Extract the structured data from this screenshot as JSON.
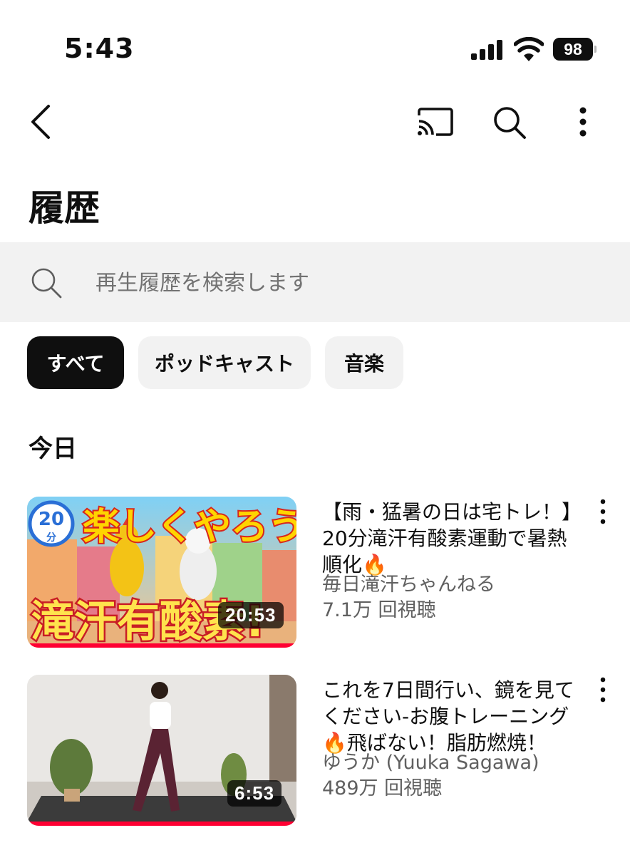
{
  "status_bar": {
    "time": "5:43",
    "battery": "98"
  },
  "header": {
    "back_icon": "chevron-left-icon",
    "cast_icon": "cast-icon",
    "search_icon": "search-icon",
    "more_icon": "more-vertical-icon",
    "title": "履歴"
  },
  "search": {
    "placeholder": "再生履歴を検索します"
  },
  "chips": [
    {
      "label": "すべて",
      "active": true
    },
    {
      "label": "ポッドキャスト",
      "active": false
    },
    {
      "label": "音楽",
      "active": false
    }
  ],
  "section_title": "今日",
  "videos": [
    {
      "title_line1": "【雨・猛暑の日は宅トレ！】",
      "title_line2": "20分滝汗有酸素運動で暑熱",
      "title_line3": "順化🔥",
      "channel": "毎日滝汗ちゃんねる",
      "views": "7.1万 回視聴",
      "duration": "20:53",
      "thumb_text_top": "楽しくやろう!",
      "thumb_text_bottom": "滝汗有酸素!",
      "thumb_badge_num": "20",
      "thumb_badge_unit": "分"
    },
    {
      "title_line1": "これを7日間行い、鏡を見て",
      "title_line2": "ください-お腹トレーニング",
      "title_line3": "🔥飛ばない！脂肪燃焼！",
      "channel": "ゆうか (Yuuka Sagawa)",
      "views": "489万 回視聴",
      "duration": "6:53"
    }
  ],
  "colors": {
    "accent": "#0f0f0f",
    "chip_bg": "#f2f2f2",
    "meta_text": "#606060",
    "progress_red": "#ff0033"
  }
}
